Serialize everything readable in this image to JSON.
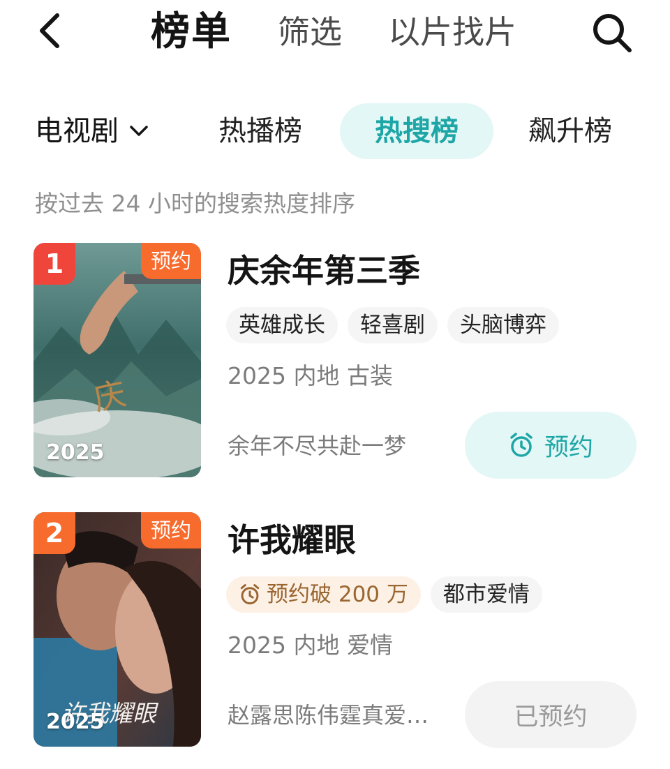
{
  "header": {
    "title": "榜单",
    "tabs": [
      "筛选",
      "以片找片"
    ]
  },
  "filters": {
    "category": "电视剧",
    "pills": [
      "热播榜",
      "热搜榜",
      "飙升榜"
    ],
    "active": "热搜榜"
  },
  "description": "按过去 24 小时的搜索热度排序",
  "items": [
    {
      "rank": "1",
      "badge": "预约",
      "poster_year": "2025",
      "title": "庆余年第三季",
      "tags": [
        "英雄成长",
        "轻喜剧",
        "头脑博弈"
      ],
      "meta": "2025 内地 古装",
      "slogan": "余年不尽共赴一梦",
      "button": "预约"
    },
    {
      "rank": "2",
      "badge": "预约",
      "poster_year": "2025",
      "title": "许我耀眼",
      "hot_tag": "预约破 200 万",
      "tags": [
        "都市爱情"
      ],
      "meta": "2025 内地 爱情",
      "slogan": "赵露思陈伟霆真爱…",
      "button": "已预约"
    }
  ],
  "colors": {
    "accent": "#1ea6a6",
    "accent_bg": "#e3f7f6",
    "badge": "#f76b2d",
    "rank1": "#f0453a",
    "rank2": "#f76b2d"
  }
}
